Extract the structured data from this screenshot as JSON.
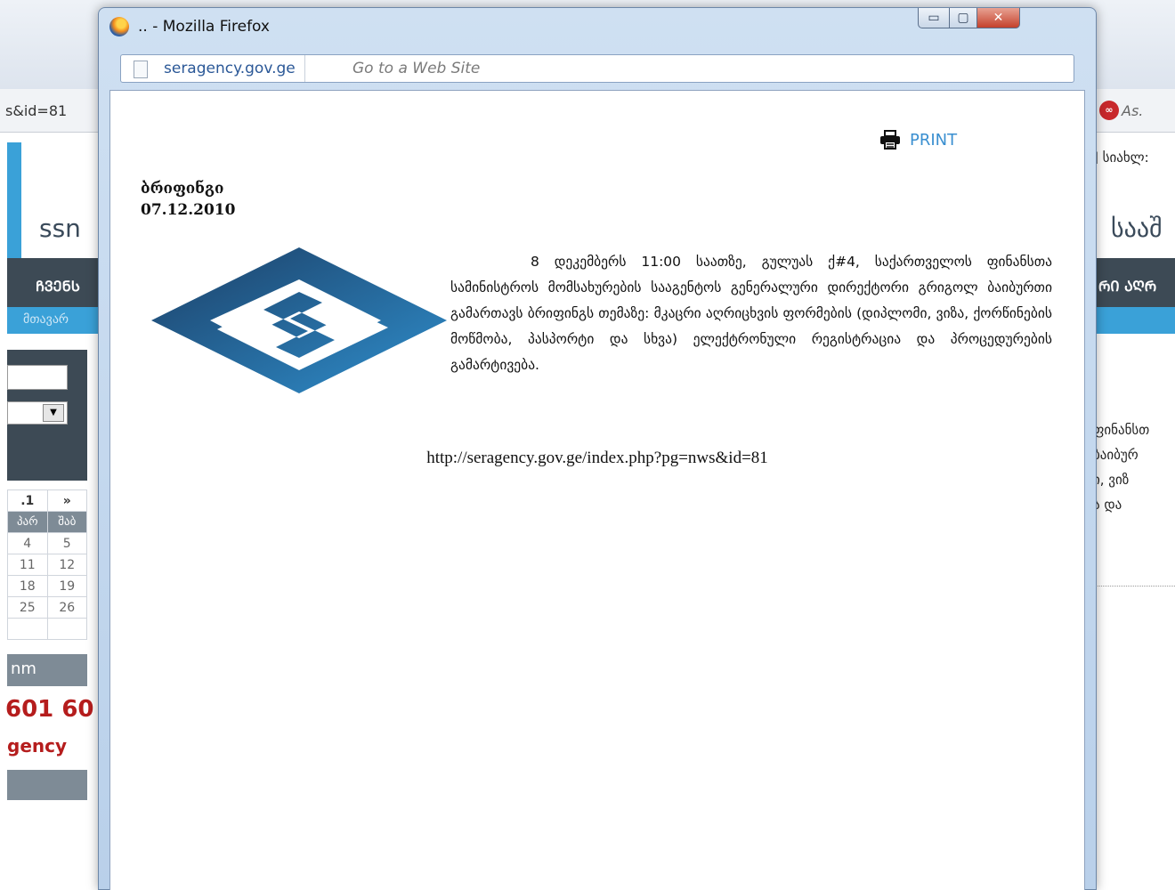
{
  "background": {
    "url_fragment": "s&id=81",
    "as_text": "As.",
    "right_header": "] სიახლ:",
    "left_title": "ssn",
    "right_title": "სააშ",
    "dark_left": "ᲩᲕᲔᲜᲡ",
    "dark_right": "ᲠᲘ ᲐᲦᲠ",
    "blue_left": "მთავარ",
    "calendar": {
      "nav": [
        ".1",
        "»"
      ],
      "header": [
        "პარ",
        "შაბ"
      ],
      "rows": [
        [
          "4",
          "5"
        ],
        [
          "11",
          "12"
        ],
        [
          "18",
          "19"
        ],
        [
          "25",
          "26"
        ],
        [
          "",
          ""
        ]
      ]
    },
    "gray_bar_text": "nm",
    "phone": "601 60",
    "agency": "gency",
    "right_lines": [
      "ფინანსთ",
      "ბაიბურ",
      "ი, ვიზ",
      "ა და"
    ]
  },
  "window": {
    "title": ".. - Mozilla Firefox",
    "minimize": "▭",
    "maximize": "▢",
    "close": "✕",
    "site_button": "seragency.gov.ge",
    "address_placeholder": "Go to a Web Site"
  },
  "content": {
    "print_label": "PRINT",
    "title": "ბრიფინგი",
    "date": "07.12.2010",
    "body": "8 დეკემბერს 11:00 საათზე, გულუას ქ#4, საქართველოს ფინანსთა სამინისტროს მომსახურების სააგენტოს გენერალური დირექტორი გრიგოლ ბაიბურთი გამართავს ბრიფინგს თემაზე: მკაცრი აღრიცხვის ფორმების (დიპლომი, ვიზა, ქორწინების მოწმობა, პასპორტი და სხვა) ელექტრონული რეგისტრაცია და პროცედურების გამარტივება.",
    "link": "http://seragency.gov.ge/index.php?pg=nws&id=81"
  },
  "colors": {
    "accent": "#3a8fd0",
    "logo_dark": "#1c3f66",
    "logo_light": "#2e86c4"
  }
}
